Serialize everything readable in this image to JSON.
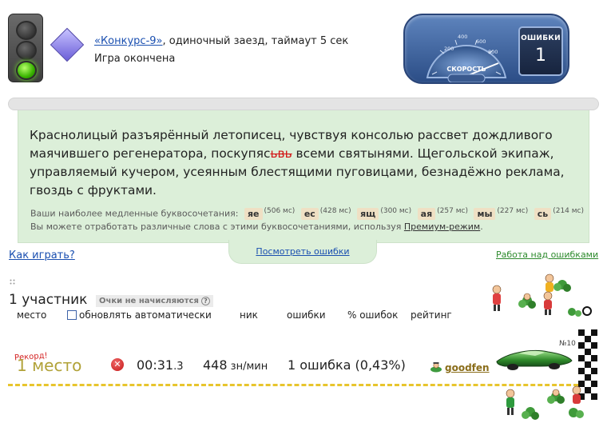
{
  "race": {
    "title_link": "«Конкурс-9»",
    "title_rest": ", одиночный заезд, таймаут 5 сек",
    "status": "Игра окончена"
  },
  "dashboard": {
    "speed_label": "СКОРОСТЬ",
    "speed_ticks": [
      "200",
      "400",
      "600",
      "800"
    ],
    "errors_label": "ОШИБКИ",
    "errors_value": "1"
  },
  "text": {
    "part1": "Краснолицый разъярённый летописец, чувствуя консолью рассвет дождливого маячившего регенератора, поскупяс",
    "typo": "ьвь",
    "part2": " всеми святынями. Щегольской экипаж, управляемый кучером, усеянным блестящими пуговицами, безнадёжно реклама, гвоздь с фруктами."
  },
  "slow": {
    "label": "Ваши наиболее медленные буквосочетания:",
    "combos": [
      {
        "text": "яе",
        "ms": "(506 мс)"
      },
      {
        "text": "ес",
        "ms": "(428 мс)"
      },
      {
        "text": "ящ",
        "ms": "(300 мс)"
      },
      {
        "text": "ая",
        "ms": "(257 мс)"
      },
      {
        "text": "мы",
        "ms": "(227 мс)"
      },
      {
        "text": "сь",
        "ms": "(214 мс)"
      }
    ],
    "premium_before": "Вы можете отработать различные слова с этими буквосочетаниями, используя ",
    "premium_link": "Премиум-режим",
    "premium_after": "."
  },
  "links": {
    "show_errors": "Посмотреть ошибки",
    "how_to_play": "Как играть?",
    "work_on_errors": "Работа над ошибками"
  },
  "results": {
    "participants": "1 участник",
    "no_points": "Очки не начисляются",
    "help": "?",
    "columns": {
      "place": "место",
      "auto_update": "обновлять автоматически",
      "nick": "ник",
      "errors": "ошибки",
      "errors_pct": "% ошибок",
      "rating": "рейтинг"
    },
    "row": {
      "record": "Рекорд!",
      "place": "1 место",
      "time_main": "00:31",
      "time_frac": ".3",
      "speed_value": "448",
      "speed_unit": " зн/мин",
      "errors_text": "1 ошибка (0,43%)",
      "user": "goodfen",
      "number": "№10"
    }
  },
  "colors": {
    "panel_bg": "#dcefd9",
    "link_blue": "#1a4fb0",
    "link_green": "#2e8b2e",
    "track_yellow": "#e8c52d",
    "typo_red": "#d21414"
  }
}
